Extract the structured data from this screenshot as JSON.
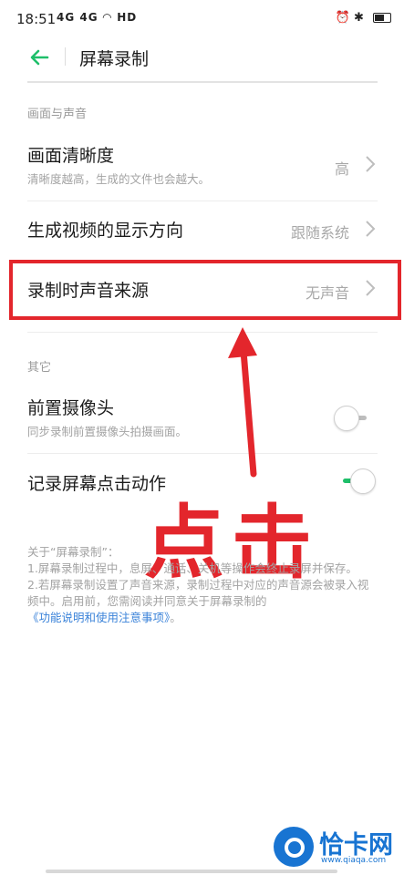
{
  "status_bar": {
    "time": "18:51",
    "signals": "4G 4G",
    "network": "HD",
    "right_icons": "⏰ ✱"
  },
  "header": {
    "title": "屏幕录制"
  },
  "sections": {
    "picture_sound_label": "画面与声音",
    "other_label": "其它"
  },
  "rows": {
    "clarity": {
      "title": "画面清晰度",
      "subtitle": "清晰度越高，生成的文件也会越大。",
      "value": "高"
    },
    "orientation": {
      "title": "生成视频的显示方向",
      "value": "跟随系统"
    },
    "audio_source": {
      "title": "录制时声音来源",
      "value": "无声音"
    },
    "front_camera": {
      "title": "前置摄像头",
      "subtitle": "同步录制前置摄像头拍摄画面。",
      "enabled": false
    },
    "record_taps": {
      "title": "记录屏幕点击动作",
      "enabled": true
    }
  },
  "info": {
    "line1": "关于“屏幕录制”：",
    "line2": "1.屏幕录制过程中，息屏、通话、关机等操作会终止录屏并保存。",
    "line3": "2.若屏幕录制设置了声音来源，录制过程中对应的声音源会被录入视频中。启用前，您需阅读并同意关于屏幕录制的",
    "link": "《功能说明和使用注意事项》",
    "tail": "。"
  },
  "annotation": {
    "text": "点击"
  },
  "watermark": {
    "text": "恰卡网",
    "sub": "www.qiaqa.com"
  },
  "colors": {
    "accent": "#1fbf6a",
    "annotation_red": "#e3262c",
    "link_blue": "#3b83d9"
  }
}
